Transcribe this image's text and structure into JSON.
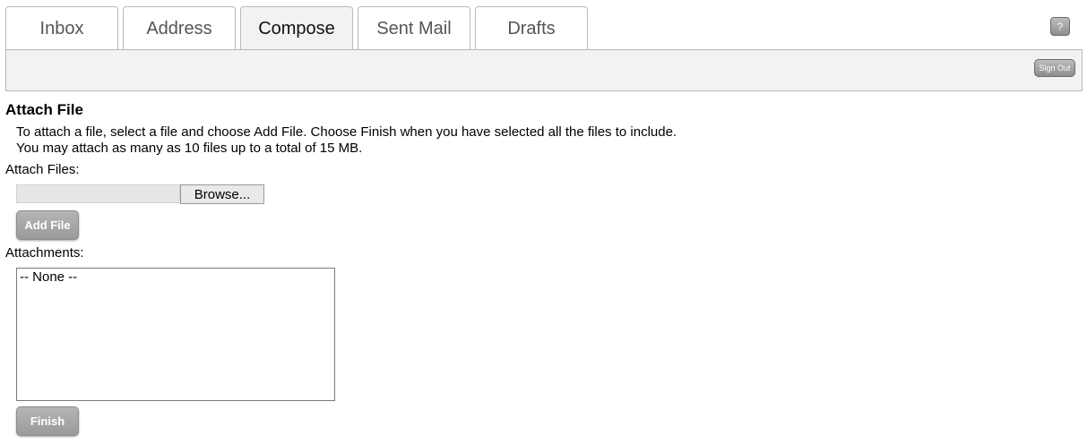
{
  "tabs": [
    {
      "label": "Inbox",
      "active": false
    },
    {
      "label": "Address",
      "active": false
    },
    {
      "label": "Compose",
      "active": true
    },
    {
      "label": "Sent Mail",
      "active": false
    },
    {
      "label": "Drafts",
      "active": false
    }
  ],
  "header": {
    "help_label": "?",
    "signout_label": "Sign Out"
  },
  "main": {
    "title": "Attach File",
    "instructions": [
      "To attach a file, select a file and choose Add File. Choose Finish when you have selected all the files to include.",
      "You may attach as many as 10 files up to a total of 15 MB."
    ],
    "attach_files_label": "Attach Files:",
    "file_input_value": "",
    "browse_label": "Browse...",
    "add_file_label": "Add File",
    "attachments_label": "Attachments:",
    "attachments": [
      "-- None --"
    ],
    "finish_label": "Finish"
  },
  "colors": {
    "active_tab_bg": "#f2f2f2",
    "button_gray": "#a8a8a8"
  }
}
